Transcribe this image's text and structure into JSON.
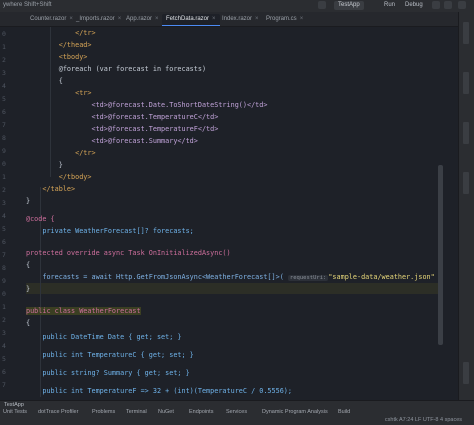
{
  "topbar": {
    "left_text": "ywhere    Shift+Shift",
    "run_config": "TestApp",
    "run_label": "Run",
    "debug_label": "Debug"
  },
  "tabs": {
    "sub_label": "ywhere",
    "items": [
      {
        "label": "Counter.razor"
      },
      {
        "label": "_Imports.razor"
      },
      {
        "label": "App.razor"
      },
      {
        "label": "FetchData.razor",
        "active": true
      },
      {
        "label": "Index.razor"
      },
      {
        "label": "Program.cs"
      }
    ]
  },
  "code": {
    "lines": [
      "            </tr>",
      "        </thead>",
      "        <tbody>",
      "        @foreach (var forecast in forecasts)",
      "        {",
      "            <tr>",
      "                <td>@forecast.Date.ToShortDateString()</td>",
      "                <td>@forecast.TemperatureC</td>",
      "                <td>@forecast.TemperatureF</td>",
      "                <td>@forecast.Summary</td>",
      "            </tr>",
      "        }",
      "        </tbody>",
      "    </table>",
      "}",
      "@code {",
      "    private WeatherForecast[]? forecasts;",
      "protected override async Task OnInitializedAsync()",
      "{",
      "    forecasts = await Http.GetFromJsonAsync<WeatherForecast[]>(",
      "}",
      "public class WeatherForecast",
      "{",
      "    public DateTime Date { get; set; }",
      "    public int TemperatureC { get; set; }",
      "    public string? Summary { get; set; }",
      "    public int TemperatureF => 32 + (int)(TemperatureC / 0.5556);",
      "}",
      "}"
    ],
    "hint_param": "requestUri:",
    "json_path": "\"sample-data/weather.json\""
  },
  "bottom": {
    "breadcrumb": "TestApp",
    "tools": [
      "Unit Tests",
      "dotTrace Profiler",
      "Problems",
      "Terminal",
      "NuGet",
      "Endpoints",
      "Services",
      "Dynamic Program Analysis",
      "Build"
    ],
    "status": [
      "cshtk",
      "A7:24",
      "LF",
      "UTF-8",
      "4 spaces"
    ]
  },
  "colors": {
    "accent": "#4c8bf5",
    "keyword": "#cf6f9d",
    "type": "#6fb3ea",
    "string": "#e8d87a"
  }
}
